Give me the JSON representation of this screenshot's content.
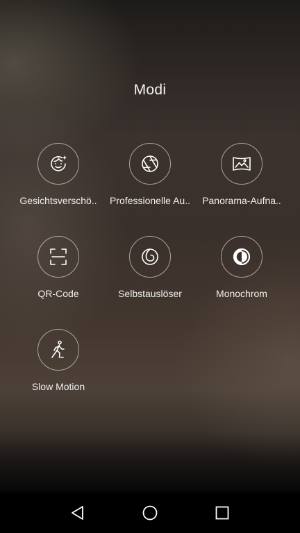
{
  "screen": {
    "title": "Modi"
  },
  "modes": [
    {
      "label": "Gesichtsverschö..",
      "icon": "face-beauty-icon"
    },
    {
      "label": "Professionelle Au..",
      "icon": "aperture-icon"
    },
    {
      "label": "Panorama-Aufna..",
      "icon": "panorama-icon"
    },
    {
      "label": "QR-Code",
      "icon": "qr-scan-icon"
    },
    {
      "label": "Selbstauslöser",
      "icon": "timer-icon"
    },
    {
      "label": "Monochrom",
      "icon": "monochrome-icon"
    },
    {
      "label": "Slow Motion",
      "icon": "running-person-icon"
    }
  ],
  "navigation": {
    "back": "back-triangle-icon",
    "home": "home-circle-icon",
    "recents": "recents-square-icon"
  },
  "colors": {
    "text": "#ffffff",
    "icon_stroke": "#ffffff",
    "navbar": "#000000"
  }
}
